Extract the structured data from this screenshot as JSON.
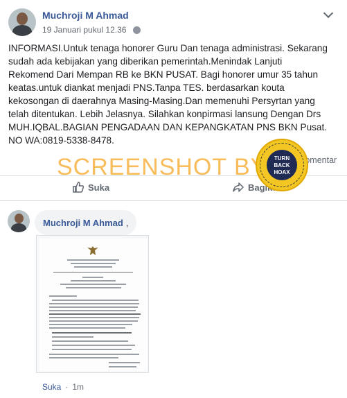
{
  "post": {
    "author": "Muchroji M Ahmad",
    "date": "19 Januari pukul 12.36",
    "text_lines": [
      "INFORMASI.Untuk tenaga honorer Guru Dan tenaga administrasi. Sekarang",
      "sudah ada kebijakan yang diberikan pemerintah.Menindak Lanjuti",
      "Rekomend Dari Mempan RB ke BKN PUSAT. Bagi honorer umur 35 tahun",
      "keatas.untuk diankat menjadi PNS.Tanpa TES. berdasarkan kouta",
      "kekosongan di daerahnya Masing-Masing.Dan memenuhi Persyrtan yang",
      "telah ditentukan. Lebih Jelasnya. Silahkan konpirmasi lansung Dengan Drs",
      "MUH.IQBAL.BAGIAN PENGADAAN DAN KEPANGKATAN PNS BKN Pusat.",
      "NO WA:0819-5338-8478."
    ],
    "comments_label": "Komentar",
    "like_label": "Suka",
    "share_label": "Bagikan"
  },
  "watermark": {
    "text": "SCREENSHOT BY",
    "badge_main": "TURN BACK HOAX",
    "badge_top": "MASYARAKAT ANTI FITNAH INDONESIA",
    "badge_bottom": "MAFINDO"
  },
  "comment": {
    "author": "Muchroji M Ahmad",
    "suffix": ",",
    "like_label": "Suka",
    "separator": "·",
    "time": "1m"
  },
  "colors": {
    "link": "#385898",
    "watermark": "#f5a523",
    "badge": "#f3c623"
  },
  "icons": [
    "chevron-down-icon",
    "globe-icon",
    "like-icon",
    "share-icon"
  ]
}
